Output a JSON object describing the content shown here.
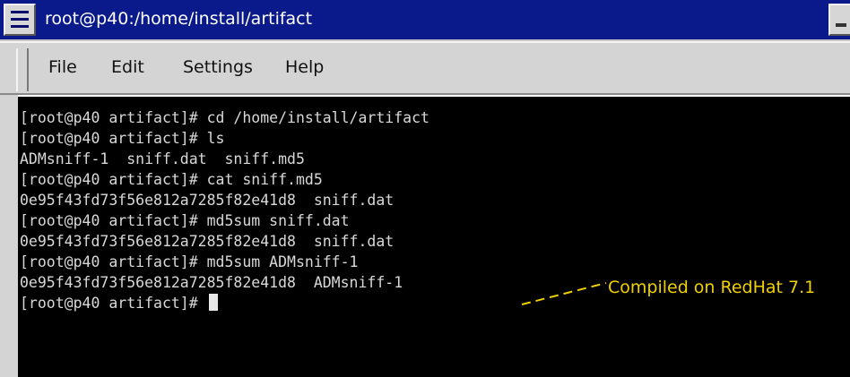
{
  "window": {
    "title": "root@p40:/home/install/artifact"
  },
  "menu": {
    "items": [
      "File",
      "Edit",
      "Settings",
      "Help"
    ]
  },
  "terminal": {
    "lines": [
      "[root@p40 artifact]# cd /home/install/artifact",
      "[root@p40 artifact]# ls",
      "ADMsniff-1  sniff.dat  sniff.md5",
      "[root@p40 artifact]# cat sniff.md5",
      "0e95f43fd73f56e812a7285f82e41d8  sniff.dat",
      "[root@p40 artifact]# md5sum sniff.dat",
      "0e95f43fd73f56e812a7285f82e41d8  sniff.dat",
      "[root@p40 artifact]# md5sum ADMsniff-1",
      "0e95f43fd73f56e812a7285f82e41d8  ADMsniff-1",
      "[root@p40 artifact]# "
    ]
  },
  "annotation": {
    "text": "Compiled on RedHat 7.1",
    "color": "#f0d000"
  },
  "colors": {
    "titlebar": "#0a1a8a",
    "terminal_bg": "#000000",
    "terminal_fg": "#d8d8d8"
  }
}
